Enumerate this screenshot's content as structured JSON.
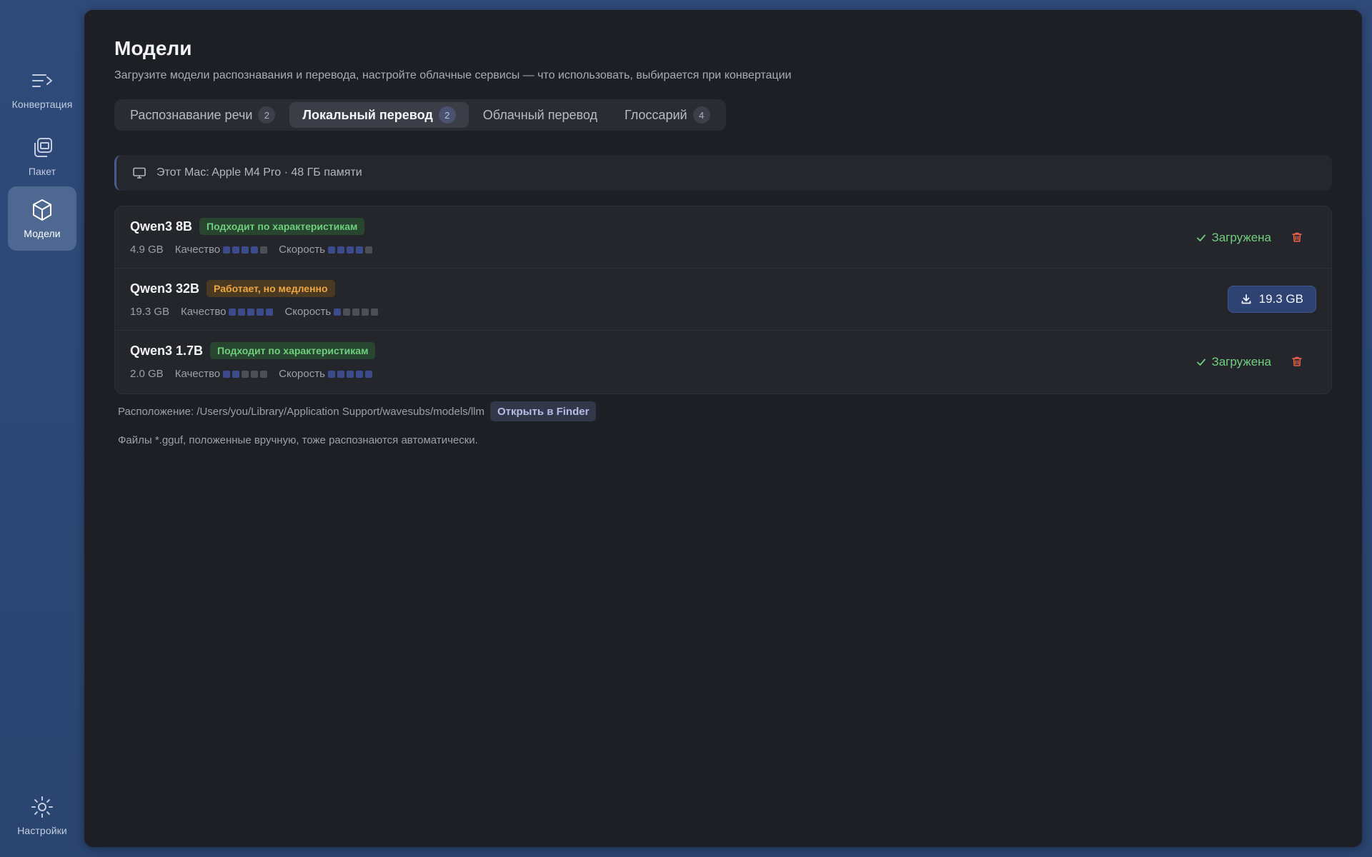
{
  "sidebar": {
    "items": [
      {
        "label": "Конвертация",
        "icon": "convert-icon"
      },
      {
        "label": "Пакет",
        "icon": "batch-icon"
      },
      {
        "label": "Модели",
        "icon": "cube-icon",
        "active": true
      }
    ],
    "settings": {
      "label": "Настройки",
      "icon": "gear-icon"
    }
  },
  "page": {
    "title": "Модели",
    "subtitle": "Загрузите модели распознавания и перевода, настройте облачные сервисы — что использовать, выбирается при конвертации"
  },
  "tabs": [
    {
      "label": "Распознавание речи",
      "badge": "2"
    },
    {
      "label": "Локальный перевод",
      "badge": "2",
      "active": true
    },
    {
      "label": "Облачный перевод",
      "badge": ""
    },
    {
      "label": "Глоссарий",
      "badge": "4"
    }
  ],
  "device": {
    "text": "Этот Mac: Apple M4 Pro · 48 ГБ памяти",
    "icon": "monitor-icon"
  },
  "labels": {
    "quality": "Качество",
    "speed": "Скорость",
    "loaded": "Загружена"
  },
  "models": [
    {
      "name": "Qwen3 8B",
      "tag": "Подходит по характеристикам",
      "tag_type": "good",
      "size": "4.9 GB",
      "quality": 4,
      "speed": 4,
      "state": "loaded"
    },
    {
      "name": "Qwen3 32B",
      "tag": "Работает, но медленно",
      "tag_type": "slow",
      "size": "19.3 GB",
      "quality": 5,
      "speed": 1,
      "state": "download",
      "download_label": "19.3 GB"
    },
    {
      "name": "Qwen3 1.7B",
      "tag": "Подходит по характеристикам",
      "tag_type": "good",
      "size": "2.0 GB",
      "quality": 2,
      "speed": 5,
      "state": "loaded"
    }
  ],
  "rating_max": 5,
  "footer": {
    "location": "Расположение: /Users/you/Library/Application Support/wavesubs/models/llm",
    "open_finder": "Открыть в Finder",
    "hint": "Файлы *.gguf, положенные вручную, тоже распознаются автоматически."
  },
  "colors": {
    "accent": "#2f4373",
    "good": "#6fcf7e",
    "warning": "#f0a640",
    "danger": "#f0614a",
    "dot_on": "#3b4b8c",
    "dot_off": "#4c4f57"
  }
}
